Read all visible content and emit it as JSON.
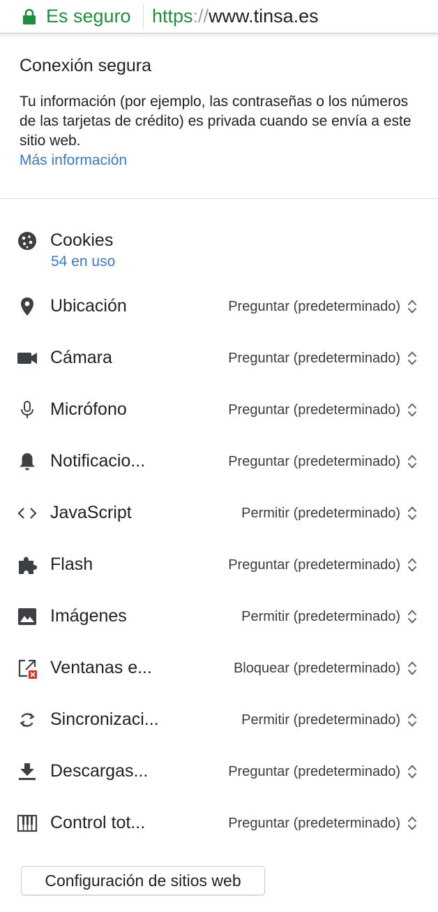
{
  "address_bar": {
    "secure_label": "Es seguro",
    "url_scheme": "https",
    "url_slashes": "://",
    "url_host": "www.tinsa.es",
    "secure_color": "#1e8e3e"
  },
  "connection": {
    "title": "Conexión segura",
    "description": "Tu información (por ejemplo, las contraseñas o los números de las tarjetas de crédito) es privada cuando se envía a este sitio web.",
    "more_info_link": "Más información",
    "link_color": "#3b78c4"
  },
  "cookies": {
    "label": "Cookies",
    "in_use": "54 en uso",
    "icon": "cookie-icon"
  },
  "permissions": [
    {
      "label": "Ubicación",
      "value": "Preguntar (predeterminado)",
      "icon": "location-icon"
    },
    {
      "label": "Cámara",
      "value": "Preguntar (predeterminado)",
      "icon": "camera-icon"
    },
    {
      "label": "Micrófono",
      "value": "Preguntar (predeterminado)",
      "icon": "microphone-icon"
    },
    {
      "label": "Notificacio...",
      "value": "Preguntar (predeterminado)",
      "icon": "bell-icon"
    },
    {
      "label": "JavaScript",
      "value": "Permitir (predeterminado)",
      "icon": "code-icon"
    },
    {
      "label": "Flash",
      "value": "Preguntar (predeterminado)",
      "icon": "puzzle-icon"
    },
    {
      "label": "Imágenes",
      "value": "Permitir (predeterminado)",
      "icon": "image-icon"
    },
    {
      "label": "Ventanas e...",
      "value": "Bloquear (predeterminado)",
      "icon": "popup-blocked-icon"
    },
    {
      "label": "Sincronizaci...",
      "value": "Permitir (predeterminado)",
      "icon": "sync-icon"
    },
    {
      "label": "Descargas...",
      "value": "Preguntar (predeterminado)",
      "icon": "download-icon"
    },
    {
      "label": "Control tot...",
      "value": "Preguntar (predeterminado)",
      "icon": "midi-piano-icon"
    }
  ],
  "footer": {
    "site_settings_button": "Configuración de sitios web"
  }
}
